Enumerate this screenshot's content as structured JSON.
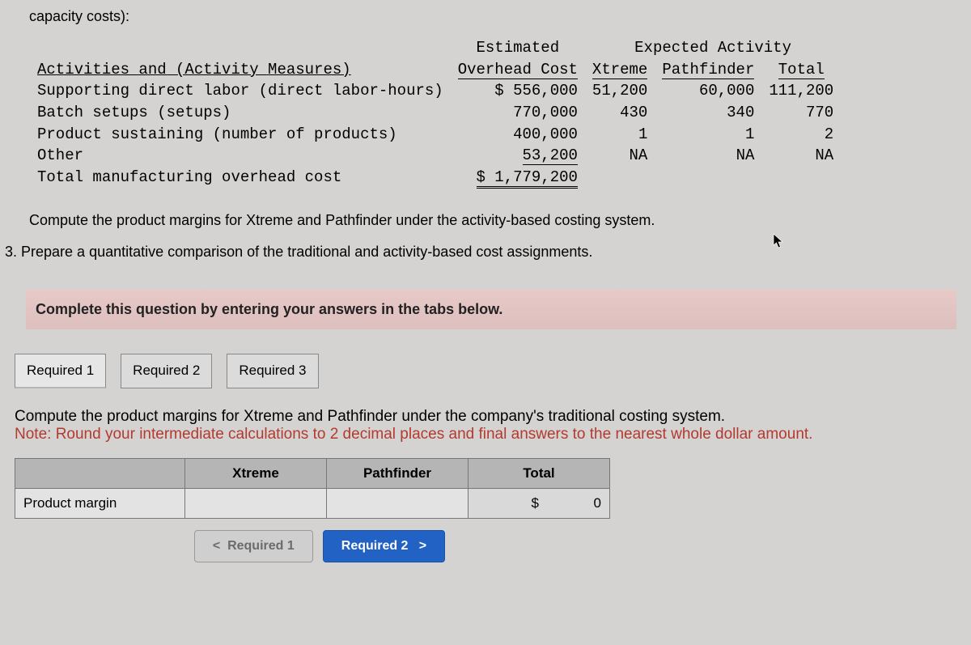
{
  "intro_line": "capacity costs):",
  "overhead": {
    "col_headers": {
      "activities": "Activities and (Activity Measures)",
      "estimated_1": "Estimated",
      "estimated_2": "Overhead Cost",
      "expected": "Expected Activity",
      "xtreme": "Xtreme",
      "pathfinder": "Pathfinder",
      "total": "Total"
    },
    "rows": [
      {
        "label": "Supporting direct labor (direct labor-hours)",
        "cost": "$ 556,000",
        "x": "51,200",
        "p": "60,000",
        "t": "111,200"
      },
      {
        "label": "Batch setups (setups)",
        "cost": "770,000",
        "x": "430",
        "p": "340",
        "t": "770"
      },
      {
        "label": "Product sustaining (number of products)",
        "cost": "400,000",
        "x": "1",
        "p": "1",
        "t": "2"
      },
      {
        "label": "Other",
        "cost": "53,200",
        "x": "NA",
        "p": "NA",
        "t": "NA"
      }
    ],
    "total_label": "Total manufacturing overhead cost",
    "total_value": "$ 1,779,200"
  },
  "compute_text": "Compute the product margins for Xtreme and Pathfinder under the activity-based costing system.",
  "q3_text": "3. Prepare a quantitative comparison of the traditional and activity-based cost assignments.",
  "instruction": "Complete this question by entering your answers in the tabs below.",
  "tabs": [
    {
      "label": "Required 1"
    },
    {
      "label": "Required 2"
    },
    {
      "label": "Required 3"
    }
  ],
  "tab_instruction_main": "Compute the product margins for Xtreme and Pathfinder under the company's traditional costing system.",
  "tab_instruction_note": "Note: Round your intermediate calculations to 2 decimal places and final answers to the nearest whole dollar amount.",
  "answer_table": {
    "headers": {
      "xtreme": "Xtreme",
      "pathfinder": "Pathfinder",
      "total": "Total"
    },
    "row_label": "Product margin",
    "total_prefix": "$",
    "total_value": "0"
  },
  "nav": {
    "prev_sym": "<",
    "prev_label": "Required 1",
    "next_label": "Required 2",
    "next_sym": ">"
  }
}
